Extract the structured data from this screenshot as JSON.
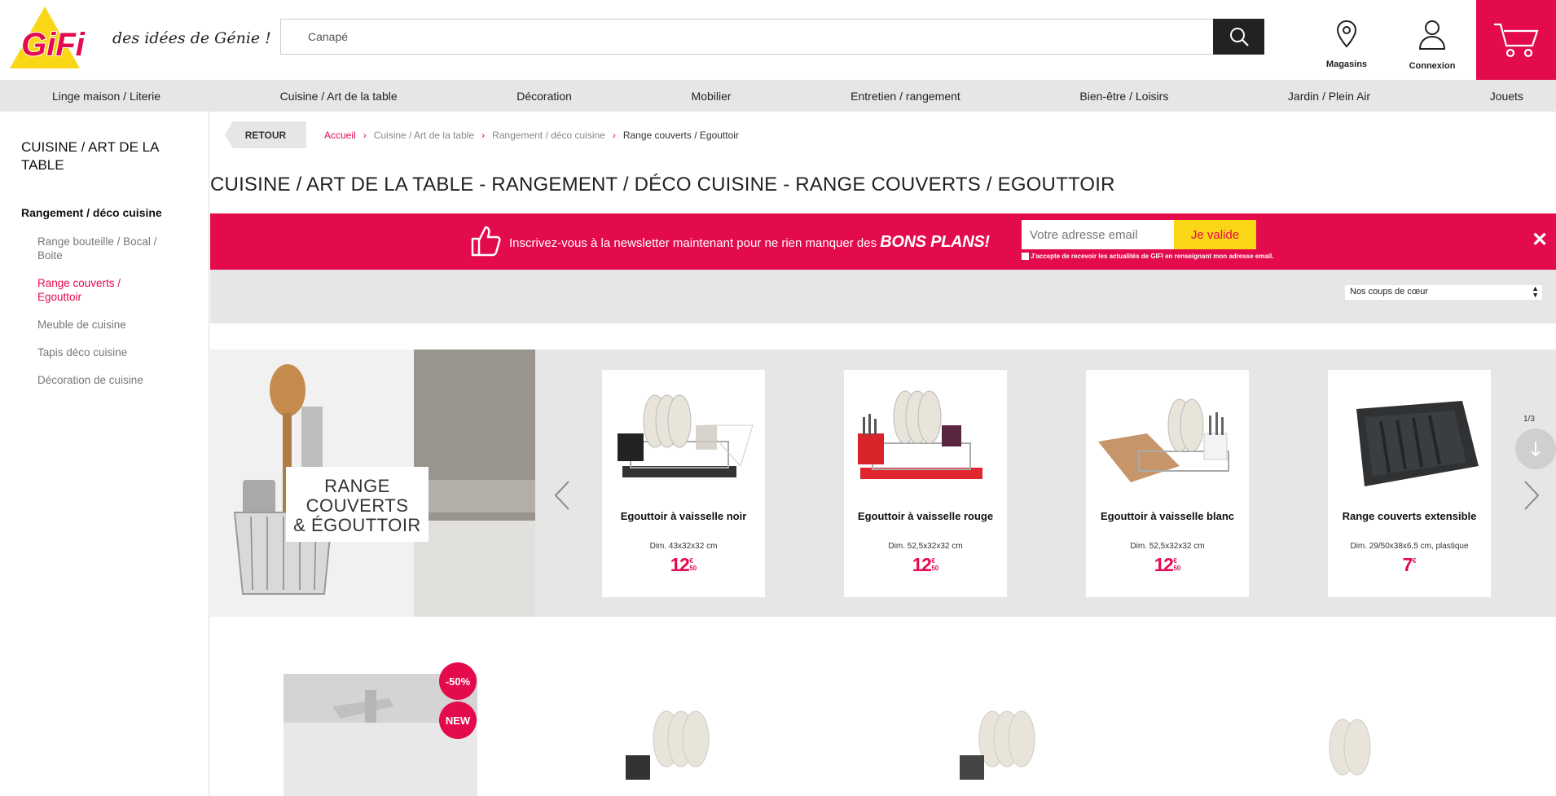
{
  "header": {
    "logo_text": "GiFi",
    "tagline": "des idées de Génie !",
    "search": {
      "value": "Canapé"
    },
    "links": [
      {
        "label": "Magasins",
        "icon": "map-pin-icon"
      },
      {
        "label": "Connexion",
        "icon": "user-icon"
      }
    ],
    "cart_icon": "cart-icon",
    "brand_color": "#e40b4d"
  },
  "nav": {
    "items": [
      {
        "label": "Linge maison / Literie"
      },
      {
        "label": "Cuisine / Art de la table"
      },
      {
        "label": "Décoration"
      },
      {
        "label": "Mobilier"
      },
      {
        "label": "Entretien / rangement"
      },
      {
        "label": "Bien-être / Loisirs"
      },
      {
        "label": "Jardin / Plein Air"
      },
      {
        "label": "Jouets"
      }
    ]
  },
  "sidebar": {
    "title": "CUISINE / ART DE LA TABLE",
    "category": "Rangement / déco cuisine",
    "items": [
      {
        "label": "Range bouteille / Bocal / Boite"
      },
      {
        "label": "Range couverts / Egouttoir"
      },
      {
        "label": "Meuble de cuisine"
      },
      {
        "label": "Tapis déco cuisine"
      },
      {
        "label": "Décoration de cuisine"
      }
    ]
  },
  "breadcrumb": {
    "back_label": "RETOUR",
    "items": [
      "Accueil",
      "Cuisine / Art de la table",
      "Rangement / déco cuisine",
      "Range couverts / Egouttoir"
    ]
  },
  "page_title": "CUISINE / ART DE LA TABLE - RANGEMENT / DÉCO CUISINE - RANGE COUVERTS / EGOUTTOIR",
  "newsletter": {
    "text": "Inscrivez-vous à la newsletter maintenant pour ne rien manquer des ",
    "text_bold": "BONS PLANS!",
    "email_placeholder": "Votre adresse email",
    "submit_label": "Je valide",
    "consent": "J'accepte de recevoir les actualités de GIFI en renseignant mon adresse email.",
    "close": "✕"
  },
  "sort": {
    "selected": "Nos coups de cœur"
  },
  "carousel": {
    "banner_label": "RANGE COUVERTS & ÉGOUTTOIR",
    "banner_lines": [
      "RANGE",
      "COUVERTS",
      "& ÉGOUTTOIR"
    ],
    "pager": "1/3",
    "products": [
      {
        "name": "Egouttoir à vaisselle noir",
        "dim": "Dim. 43x32x32 cm",
        "price_int": "12",
        "price_cur": "€",
        "price_dec": "50"
      },
      {
        "name": "Egouttoir à vaisselle rouge",
        "dim": "Dim. 52,5x32x32 cm",
        "price_int": "12",
        "price_cur": "€",
        "price_dec": "50"
      },
      {
        "name": "Egouttoir à vaisselle blanc",
        "dim": "Dim. 52,5x32x32 cm",
        "price_int": "12",
        "price_cur": "€",
        "price_dec": "50"
      },
      {
        "name": "Range couverts extensible",
        "dim": "Dim. 29/50x38x6,5 cm, plastique",
        "price_int": "7",
        "price_cur": "€",
        "price_dec": ""
      }
    ]
  },
  "row2": {
    "badges": [
      "-50%",
      "NEW"
    ]
  }
}
